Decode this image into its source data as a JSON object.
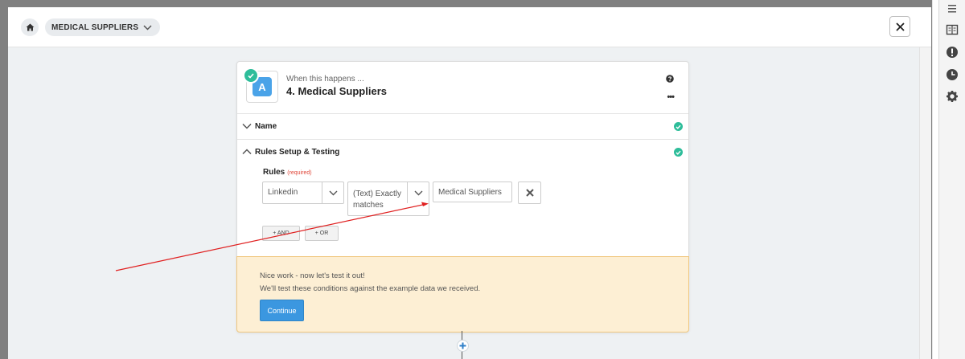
{
  "header": {
    "breadcrumb_label": "MEDICAL SUPPLIERS"
  },
  "step": {
    "app_letter": "A",
    "trigger_label": "When this happens ...",
    "title": "4. Medical Suppliers"
  },
  "sections": {
    "name_label": "Name",
    "rules_label": "Rules Setup & Testing"
  },
  "rules": {
    "label": "Rules",
    "required_tag": "(required)",
    "field_value": "Linkedin",
    "condition_line1": "(Text) Exactly",
    "condition_line2": "matches",
    "value": "Medical Suppliers",
    "and_button": "+ AND",
    "or_button": "+ OR"
  },
  "notice": {
    "line1": "Nice work - now let's test it out!",
    "line2": "We'll test these conditions against the example data we received.",
    "continue_label": "Continue"
  },
  "colors": {
    "accent": "#3b97e0",
    "success": "#2ebd9a",
    "notice_bg": "#fdefd4",
    "annotation_arrow": "#e02020"
  }
}
